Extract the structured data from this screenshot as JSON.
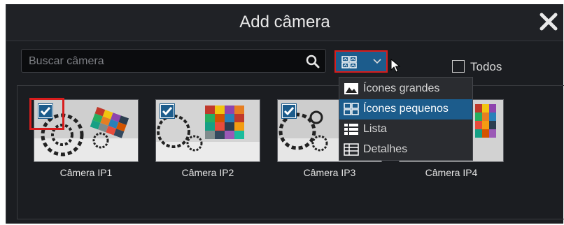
{
  "dialog": {
    "title": "Add câmera",
    "close_icon": "close-icon"
  },
  "search": {
    "placeholder": "Buscar câmera",
    "value": "",
    "icon": "search-icon"
  },
  "view_selector": {
    "icon": "small-icons-view-icon",
    "chevron": "chevron-down-icon"
  },
  "todos": {
    "label": "Todos",
    "checked": false
  },
  "view_menu": {
    "items": [
      {
        "label": "Ícones grandes",
        "icon": "large-icons-view-icon",
        "selected": false
      },
      {
        "label": "Ícones pequenos",
        "icon": "small-icons-view-icon",
        "selected": true
      },
      {
        "label": "Lista",
        "icon": "list-view-icon",
        "selected": false
      },
      {
        "label": "Detalhes",
        "icon": "details-view-icon",
        "selected": false
      }
    ]
  },
  "cameras": [
    {
      "label": "Câmera IP1",
      "checked": true
    },
    {
      "label": "Câmera IP2",
      "checked": true
    },
    {
      "label": "Câmera IP3",
      "checked": true
    },
    {
      "label": "Câmera IP4",
      "checked": false
    }
  ],
  "colors": {
    "accent": "#1c5c8c",
    "highlight": "#d81d1d",
    "background": "#1b1d21"
  }
}
